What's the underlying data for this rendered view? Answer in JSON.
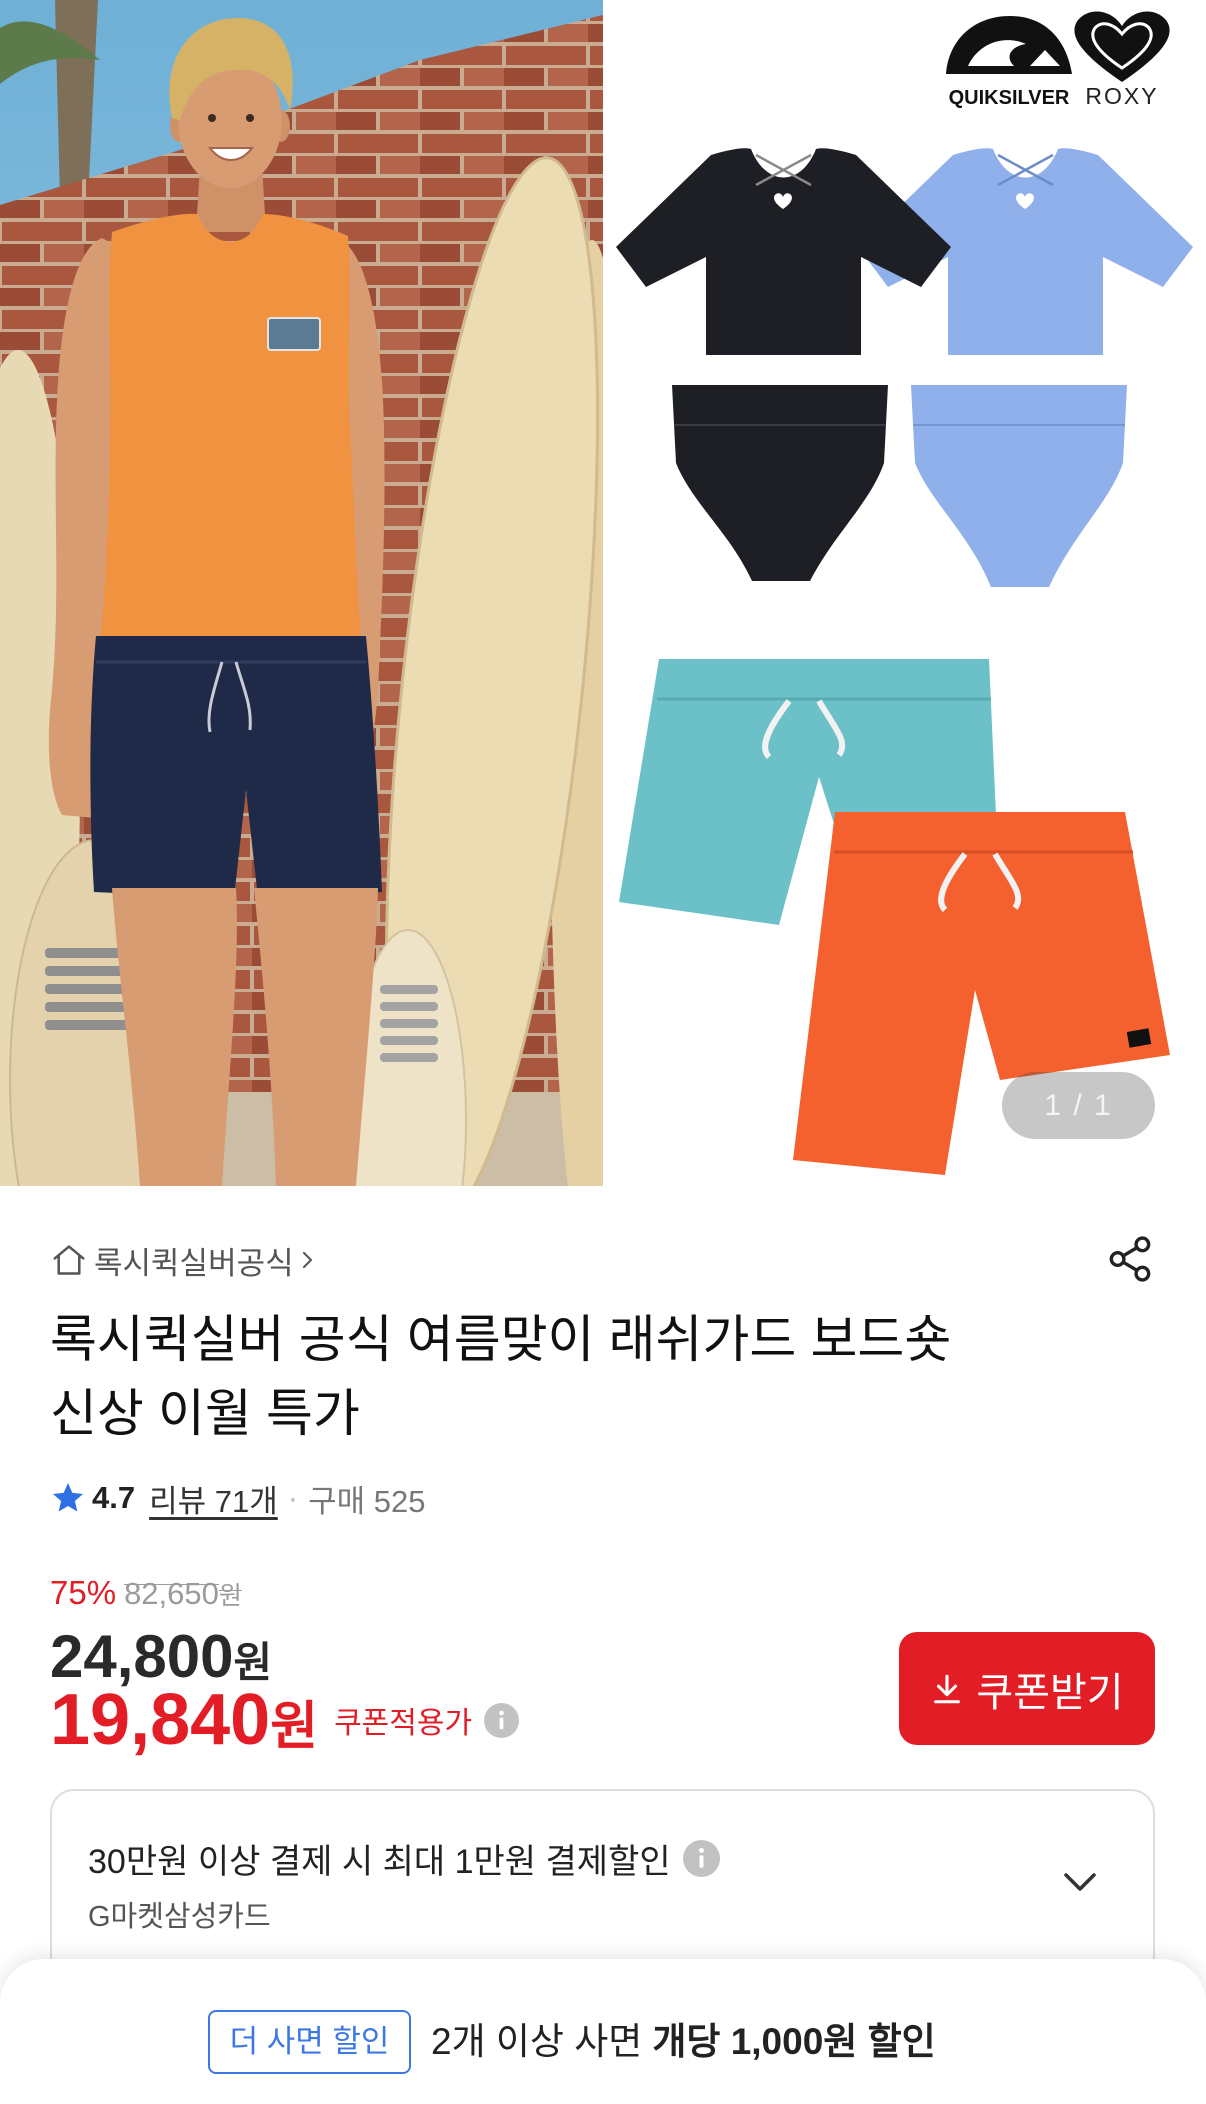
{
  "gallery": {
    "logos": {
      "quiksilver": "QUIKSILVER",
      "roxy": "ROXY"
    },
    "pagination": "1 / 1",
    "colors": {
      "tank_top": "#f0923f",
      "board_shorts_navy": "#1f2a48",
      "swim_black": "#1e1f24",
      "swim_blue": "#8fb0ea",
      "shorts_turquoise": "#6cc1c9",
      "shorts_orange": "#f4612f"
    }
  },
  "store": {
    "name": "록시퀵실버공식"
  },
  "product": {
    "title_lines": [
      "록시퀵실버 공식 여름맞이 래쉬가드 보드숏",
      "신상 이월 특가"
    ],
    "rating": {
      "score": "4.7",
      "reviews": "리뷰 71개",
      "separator": "·",
      "purchases": "구매 525"
    }
  },
  "price": {
    "discount_rate": "75%",
    "original": {
      "amount": "82,650",
      "unit": "원"
    },
    "sale": {
      "amount": "24,800",
      "unit": "원"
    },
    "coupon": {
      "amount": "19,840",
      "unit": "원",
      "label": "쿠폰적용가"
    }
  },
  "coupon_button": {
    "label": "쿠폰받기"
  },
  "card_benefit": {
    "headline": "30만원 이상 결제 시 최대 1만원 결제할인",
    "card_name": "G마켓삼성카드"
  },
  "bottom_sheet": {
    "badge": "더 사면 할인",
    "text": "2개 이상 사면",
    "highlight": "개당 1,000원 할인"
  },
  "theme": {
    "accent_red": "#e21d26",
    "accent_blue": "#3d78e3"
  }
}
